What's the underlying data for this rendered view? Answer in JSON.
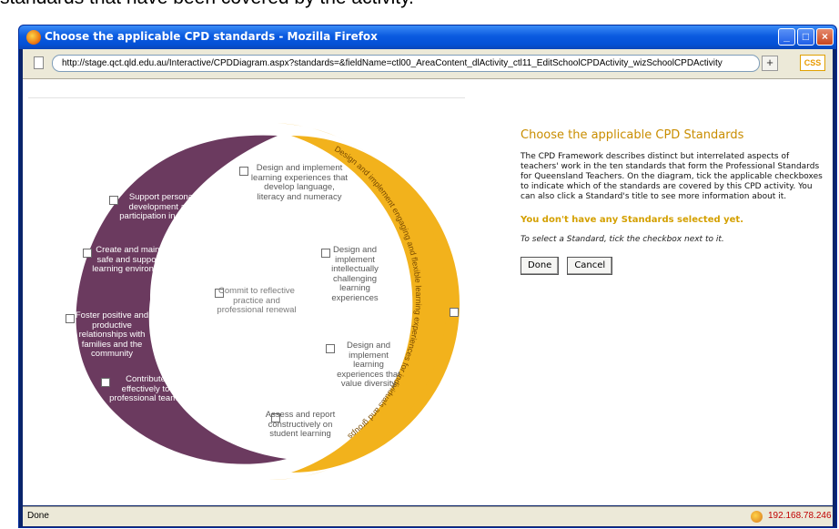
{
  "caption": "standards that have been covered by the activity.",
  "window": {
    "title": "Choose the applicable CPD standards - Mozilla Firefox",
    "url": "http://stage.qct.qld.edu.au/Interactive/CPDDiagram.aspx?standards=&fieldName=ctl00_AreaContent_dlActivity_ctl11_EditSchoolCPDActivity_wizSchoolCPDActivity",
    "css_badge": "CSS",
    "plus_label": "+"
  },
  "diagram": {
    "ring_text": "Design and implement engaging and flexible learning experiences for individuals and groups",
    "standards": [
      {
        "label": "Support personal development and participation in society"
      },
      {
        "label": "Create and maintain safe and supportive learning environments"
      },
      {
        "label": "Foster positive and productive relationships with families and the community"
      },
      {
        "label": "Contribute effectively to professional teams"
      },
      {
        "label": "Commit to reflective practice and professional renewal"
      },
      {
        "label": "Design and implement learning experiences that develop language, literacy and numeracy"
      },
      {
        "label": "Design and implement intellectually challenging learning experiences"
      },
      {
        "label": "Design and implement learning experiences that value diversity"
      },
      {
        "label": "Assess and report constructively on student learning"
      }
    ],
    "colors": {
      "purple": "#6b3a5f",
      "light_orange": "#f8d48a",
      "gold": "#f2b21c"
    }
  },
  "panel": {
    "title": "Choose the applicable CPD Standards",
    "description": "The CPD Framework describes distinct but interrelated aspects of teachers' work in the ten standards that form the Professional Standards for Queensland Teachers. On the diagram, tick the applicable checkboxes to indicate which of the standards are covered by this CPD activity. You can also click a Standard's title to see more information about it.",
    "warning": "You don't have any Standards selected yet.",
    "hint": "To select a Standard, tick the checkbox next to it.",
    "done_label": "Done",
    "cancel_label": "Cancel"
  },
  "status": {
    "text": "Done",
    "ip": "192.168.78.246"
  },
  "icons": {
    "window_icon": "firefox-icon",
    "page_icon": "page-icon",
    "status_icon": "firebug-icon"
  }
}
